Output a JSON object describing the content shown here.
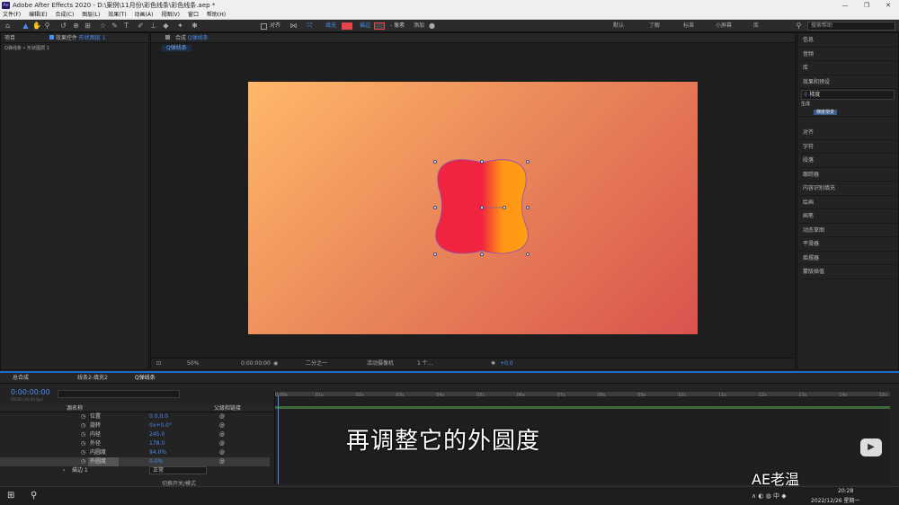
{
  "app": {
    "title": "Adobe After Effects 2020 - D:\\案例\\11月份\\彩色线条\\彩色线条.aep *",
    "logo": "Ae",
    "window_controls": [
      "—",
      "❐",
      "✕"
    ]
  },
  "menu": [
    "文件(F)",
    "编辑(E)",
    "合成(C)",
    "图层(L)",
    "效果(T)",
    "动画(A)",
    "视图(V)",
    "窗口",
    "帮助(H)"
  ],
  "toolbar": {
    "align_label": "对齐",
    "fill_label": "填充",
    "stroke_label": "描边",
    "stroke_px": "- 像素",
    "add_label": "添加",
    "fill_color": "#e8434a",
    "workspaces": [
      "默认",
      "了解",
      "标准",
      "小屏幕",
      "库"
    ],
    "search_placeholder": "搜索帮助"
  },
  "project_panel": {
    "tab_project": "项目",
    "tab_effects_prefix": "效果控件",
    "tab_effects_layer": "形状图层 1",
    "breadcrumb": "Q弹线条 • 形状图层 1"
  },
  "comp_panel": {
    "tab_label": "合成",
    "comp_name": "Q弹线条",
    "subtab": "Q弹线条",
    "bottom_bar": {
      "zoom": "50%",
      "timecode": "0:00:00:00",
      "resolution": "二分之一",
      "camera": "活动摄像机",
      "views": "1 个...",
      "exposure": "+0.0"
    }
  },
  "right_panel": {
    "items_top": [
      "信息",
      "音频",
      "库"
    ],
    "effects_presets": {
      "title": "效果和预设",
      "search_value": "梯度",
      "category": "生成",
      "result": "梯度渐变"
    },
    "items_bottom": [
      "对齐",
      "字符",
      "段落",
      "跟踪器",
      "内容识别填充",
      "绘画",
      "画笔",
      "动态草图",
      "平滑器",
      "摇摆器",
      "蒙版插值"
    ]
  },
  "timeline": {
    "tabs": [
      "总合成",
      "线条2-填充2",
      "Q弹线条"
    ],
    "current_time": "0:00:00:00",
    "fps_info": "00000 (30.00 fps)",
    "search_placeholder": "",
    "headers": {
      "source_name": "源名称",
      "parent": "父级和链接"
    },
    "properties": [
      {
        "name": "位置",
        "value": "0.0,0.0"
      },
      {
        "name": "旋转",
        "value": "0x+0.0°"
      },
      {
        "name": "内径",
        "value": "245.0"
      },
      {
        "name": "外径",
        "value": "178.0"
      },
      {
        "name": "内圆度",
        "value": "94.0%"
      },
      {
        "name": "外圆度",
        "value": "0.0%"
      }
    ],
    "stroke_row": {
      "name": "描边 1",
      "mode": "正常"
    },
    "bottom_label": "切换开关/模式",
    "ruler": [
      "0:00s",
      "01s",
      "02s",
      "03s",
      "04s",
      "05s",
      "06s",
      "07s",
      "08s",
      "09s",
      "10s",
      "11s",
      "12s",
      "13s",
      "14s",
      "15s"
    ]
  },
  "subtitle": "再调整它的外圆度",
  "watermark": "AE老温",
  "taskbar": {
    "time": "20:28",
    "date": "2022/12/26 星期一"
  }
}
